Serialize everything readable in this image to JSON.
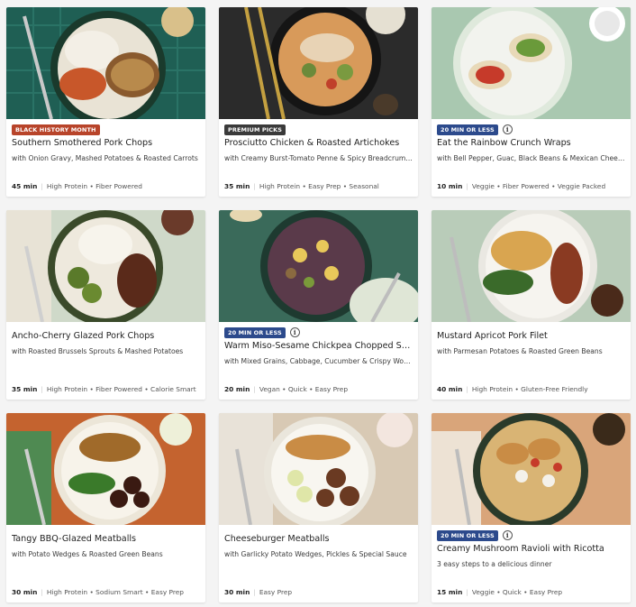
{
  "recipes": [
    {
      "badge": "BLACK HISTORY MONTH",
      "badge_color": "#b8442a",
      "info_icon": false,
      "title": "Southern Smothered Pork Chops",
      "subtitle": "with Onion Gravy, Mashed Potatoes & Roasted Carrots",
      "time": "45 min",
      "tags": "High Protein • Fiber Powered"
    },
    {
      "badge": "PREMIUM PICKS",
      "badge_color": "#3a3a3a",
      "info_icon": false,
      "title": "Prosciutto Chicken & Roasted Artichokes",
      "subtitle": "with Creamy Burst-Tomato Penne & Spicy Breadcrumbs",
      "time": "35 min",
      "tags": "High Protein • Easy Prep • Seasonal"
    },
    {
      "badge": "20 MIN OR LESS",
      "badge_color": "#2c4a8c",
      "info_icon": true,
      "title": "Eat the Rainbow Crunch Wraps",
      "subtitle": "with Bell Pepper, Guac, Black Beans & Mexican Cheese",
      "time": "10 min",
      "tags": "Veggie • Fiber Powered • Veggie Packed"
    },
    {
      "badge": "",
      "badge_color": "",
      "info_icon": false,
      "title": "Ancho-Cherry Glazed Pork Chops",
      "subtitle": "with Roasted Brussels Sprouts & Mashed Potatoes",
      "time": "35 min",
      "tags": "High Protein • Fiber Powered • Calorie Smart"
    },
    {
      "badge": "20 MIN OR LESS",
      "badge_color": "#2c4a8c",
      "info_icon": true,
      "title": "Warm Miso-Sesame Chickpea Chopped Salad",
      "subtitle": "with Mixed Grains, Cabbage, Cucumber & Crispy Wontons",
      "time": "20 min",
      "tags": "Vegan • Quick • Easy Prep"
    },
    {
      "badge": "",
      "badge_color": "",
      "info_icon": false,
      "title": "Mustard Apricot Pork Filet",
      "subtitle": "with Parmesan Potatoes & Roasted Green Beans",
      "time": "40 min",
      "tags": "High Protein • Gluten-Free Friendly"
    },
    {
      "badge": "",
      "badge_color": "",
      "info_icon": false,
      "title": "Tangy BBQ-Glazed Meatballs",
      "subtitle": "with Potato Wedges & Roasted Green Beans",
      "time": "30 min",
      "tags": "High Protein • Sodium Smart • Easy Prep"
    },
    {
      "badge": "",
      "badge_color": "",
      "info_icon": false,
      "title": "Cheeseburger Meatballs",
      "subtitle": "with Garlicky Potato Wedges, Pickles & Special Sauce",
      "time": "30 min",
      "tags": "Easy Prep"
    },
    {
      "badge": "20 MIN OR LESS",
      "badge_color": "#2c4a8c",
      "info_icon": true,
      "title": "Creamy Mushroom Ravioli with Ricotta",
      "subtitle": "3 easy steps to a delicious dinner",
      "time": "15 min",
      "tags": "Veggie • Quick • Easy Prep"
    }
  ],
  "info_icon_glyph": "i",
  "separator": "|"
}
